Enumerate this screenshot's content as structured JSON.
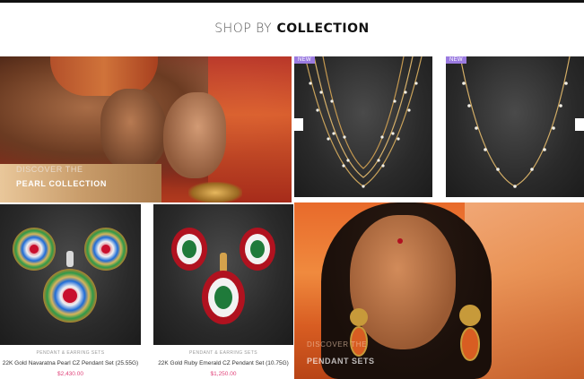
{
  "section": {
    "title_light": "SHOP BY",
    "title_bold": "COLLECTION"
  },
  "hero": {
    "caption_top": "DISCOVER THE",
    "caption_main": "PEARL COLLECTION"
  },
  "necklaces": [
    {
      "badge": "NEW"
    },
    {
      "badge": "NEW"
    }
  ],
  "products": [
    {
      "category": "PENDANT & EARRING SETS",
      "name": "22K Gold Navaratna Pearl CZ Pendant Set (25.55G)",
      "price": "$2,430.00"
    },
    {
      "category": "PENDANT & EARRING SETS",
      "name": "22K Gold Ruby Emerald CZ Pendant Set (10.75G)",
      "price": "$1,250.00"
    }
  ],
  "portrait": {
    "caption_top": "DISCOVER THE",
    "caption_main": "PENDANT SETS"
  },
  "colors": {
    "accent_price": "#e0437a",
    "badge": "#9b7be0"
  }
}
